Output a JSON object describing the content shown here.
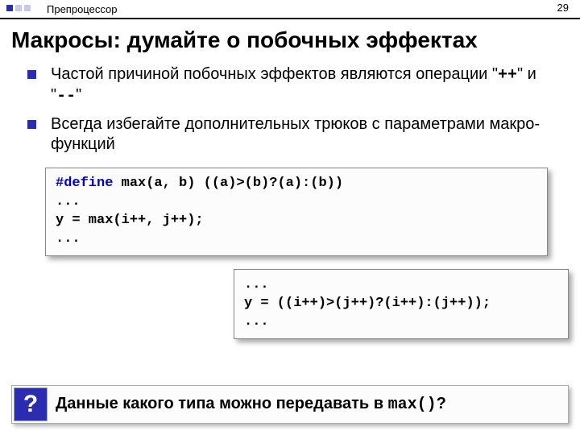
{
  "header": {
    "breadcrumb": "Препроцессор",
    "page_no": "29"
  },
  "title": "Макросы: думайте о побочных эффектах",
  "bullets": [
    {
      "pre": "Частой причиной побочных эффектов являются операции \"",
      "op1": "++",
      "mid": "\" и \"",
      "op2": "--",
      "post": "\""
    },
    {
      "text": "Всегда избегайте дополнительных трюков с параметрами макро-функций"
    }
  ],
  "code1": {
    "kw": "#define",
    "rest": " max(a, b) ((a)>(b)?(a):(b))\n...\ny = max(i++, j++);\n..."
  },
  "code2": "...\ny = ((i++)>(j++)?(i++):(j++));\n...",
  "footer": {
    "qmark": "?",
    "q_pre": "Данные какого типа можно передавать в ",
    "q_code": "max()",
    "q_post": "?"
  }
}
